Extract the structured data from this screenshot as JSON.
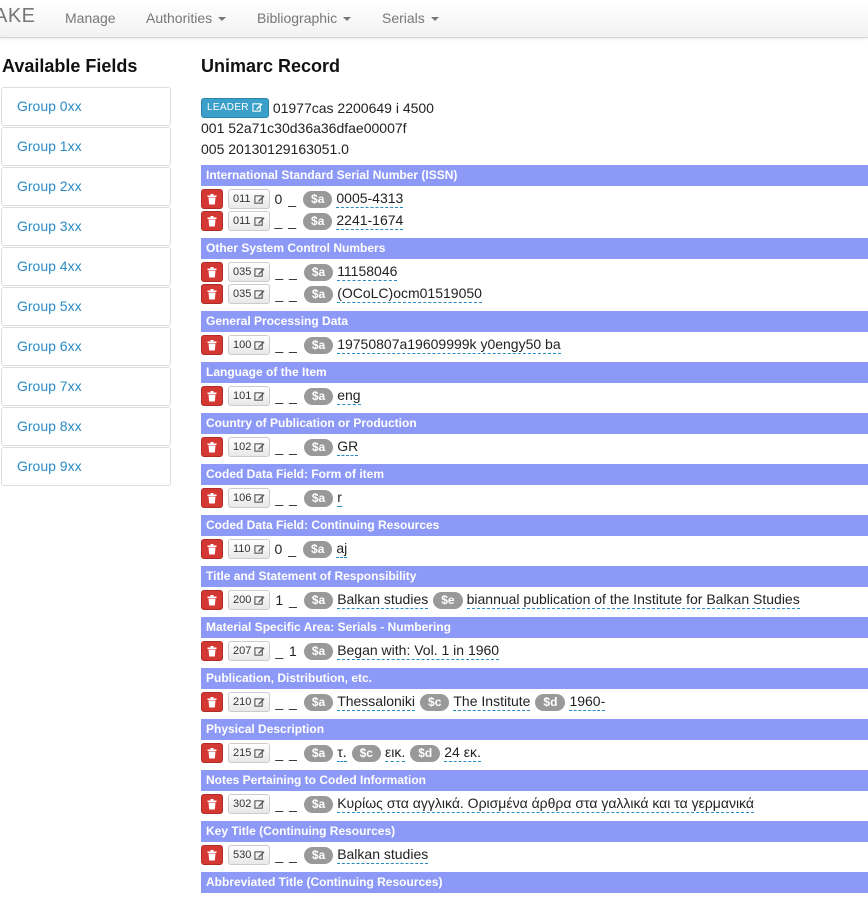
{
  "navbar": {
    "brand": "AKE",
    "items": [
      {
        "label": "Manage",
        "dropdown": false
      },
      {
        "label": "Authorities",
        "dropdown": true
      },
      {
        "label": "Bibliographic",
        "dropdown": true
      },
      {
        "label": "Serials",
        "dropdown": true
      }
    ]
  },
  "sidebar": {
    "title": "Available Fields",
    "groups": [
      "Group 0xx",
      "Group 1xx",
      "Group 2xx",
      "Group 3xx",
      "Group 4xx",
      "Group 5xx",
      "Group 6xx",
      "Group 7xx",
      "Group 8xx",
      "Group 9xx"
    ]
  },
  "record": {
    "title": "Unimarc Record",
    "leader_label": "LEADER",
    "leader_value": "01977cas 2200649 i 4500",
    "control_001": "001 52a71c30d36a36dfae00007f",
    "control_005": "005 20130129163051.0",
    "fields": [
      {
        "header": "International Standard Serial Number (ISSN)",
        "rows": [
          {
            "tag": "011",
            "ind": "0 _",
            "subs": [
              {
                "code": "$a",
                "value": "0005-4313"
              }
            ]
          },
          {
            "tag": "011",
            "ind": "_ _",
            "subs": [
              {
                "code": "$a",
                "value": "2241-1674"
              }
            ]
          }
        ]
      },
      {
        "header": "Other System Control Numbers",
        "rows": [
          {
            "tag": "035",
            "ind": "_ _",
            "subs": [
              {
                "code": "$a",
                "value": "11158046"
              }
            ]
          },
          {
            "tag": "035",
            "ind": "_ _",
            "subs": [
              {
                "code": "$a",
                "value": "(OCoLC)ocm01519050"
              }
            ]
          }
        ]
      },
      {
        "header": "General Processing Data",
        "rows": [
          {
            "tag": "100",
            "ind": "_ _",
            "subs": [
              {
                "code": "$a",
                "value": "19750807a19609999k y0engy50 ba"
              }
            ]
          }
        ]
      },
      {
        "header": "Language of the Item",
        "rows": [
          {
            "tag": "101",
            "ind": "_ _",
            "subs": [
              {
                "code": "$a",
                "value": "eng"
              }
            ]
          }
        ]
      },
      {
        "header": "Country of Publication or Production",
        "rows": [
          {
            "tag": "102",
            "ind": "_ _",
            "subs": [
              {
                "code": "$a",
                "value": "GR"
              }
            ]
          }
        ]
      },
      {
        "header": "Coded Data Field: Form of item",
        "rows": [
          {
            "tag": "106",
            "ind": "_ _",
            "subs": [
              {
                "code": "$a",
                "value": "r"
              }
            ]
          }
        ]
      },
      {
        "header": "Coded Data Field: Continuing Resources",
        "rows": [
          {
            "tag": "110",
            "ind": "0 _",
            "subs": [
              {
                "code": "$a",
                "value": "aj"
              }
            ]
          }
        ]
      },
      {
        "header": "Title and Statement of Responsibility",
        "rows": [
          {
            "tag": "200",
            "ind": "1 _",
            "subs": [
              {
                "code": "$a",
                "value": "Balkan studies"
              },
              {
                "code": "$e",
                "value": "biannual publication of the Institute for Balkan Studies"
              }
            ]
          }
        ]
      },
      {
        "header": "Material Specific Area: Serials - Numbering",
        "rows": [
          {
            "tag": "207",
            "ind": "_ 1",
            "subs": [
              {
                "code": "$a",
                "value": "Began with: Vol. 1 in 1960"
              }
            ]
          }
        ]
      },
      {
        "header": "Publication, Distribution, etc.",
        "rows": [
          {
            "tag": "210",
            "ind": "_ _",
            "subs": [
              {
                "code": "$a",
                "value": "Thessaloniki"
              },
              {
                "code": "$c",
                "value": "The Institute"
              },
              {
                "code": "$d",
                "value": "1960-"
              }
            ]
          }
        ]
      },
      {
        "header": "Physical Description",
        "rows": [
          {
            "tag": "215",
            "ind": "_ _",
            "subs": [
              {
                "code": "$a",
                "value": "τ."
              },
              {
                "code": "$c",
                "value": "εικ."
              },
              {
                "code": "$d",
                "value": "24 εκ."
              }
            ]
          }
        ]
      },
      {
        "header": "Notes Pertaining to Coded Information",
        "rows": [
          {
            "tag": "302",
            "ind": "_ _",
            "subs": [
              {
                "code": "$a",
                "value": "Κυρίως στα αγγλικά. Ορισμένα άρθρα στα γαλλικά και τα γερμανικά"
              }
            ]
          }
        ]
      },
      {
        "header": "Key Title (Continuing Resources)",
        "rows": [
          {
            "tag": "530",
            "ind": "_ _",
            "subs": [
              {
                "code": "$a",
                "value": "Balkan studies"
              }
            ]
          }
        ]
      },
      {
        "header": "Abbreviated Title (Continuing Resources)",
        "rows": []
      }
    ]
  },
  "colors": {
    "field_header_bg": "#8d99f6",
    "delete_button": "#d33833",
    "leader_button": "#3a9fc9",
    "link": "#2a8bc4",
    "subfield_badge": "#999999"
  }
}
